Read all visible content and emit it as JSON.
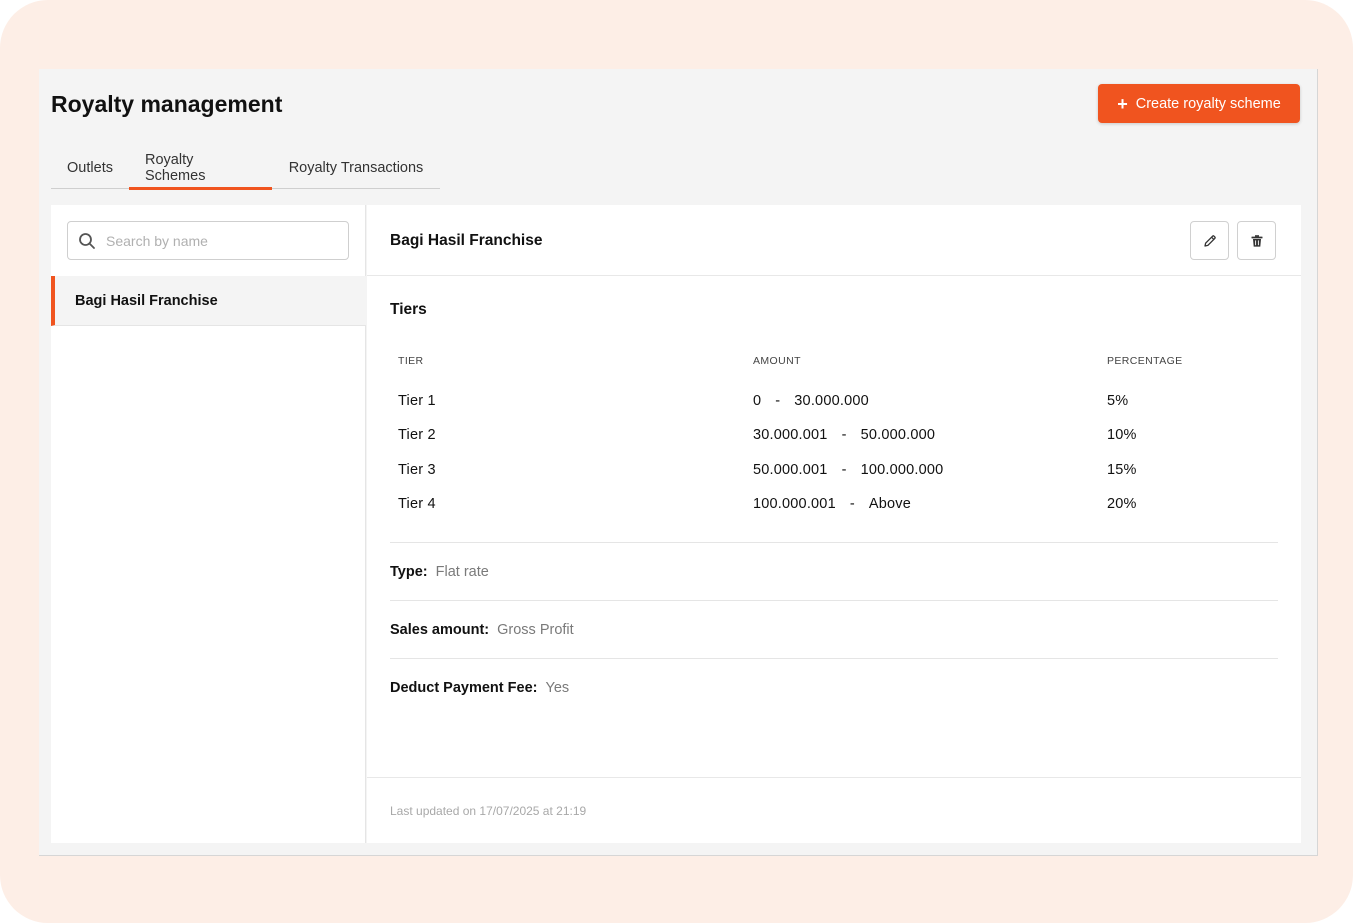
{
  "header": {
    "title": "Royalty management",
    "create_button_label": "Create royalty scheme",
    "create_button_icon": "plus-icon"
  },
  "tabs": [
    {
      "label": "Outlets",
      "active": false
    },
    {
      "label": "Royalty Schemes",
      "active": true
    },
    {
      "label": "Royalty Transactions",
      "active": false
    }
  ],
  "sidebar": {
    "search": {
      "placeholder": "Search by name",
      "value": "",
      "icon": "search-icon"
    },
    "items": [
      {
        "label": "Bagi Hasil Franchise",
        "selected": true
      }
    ]
  },
  "detail": {
    "title": "Bagi Hasil Franchise",
    "edit_icon": "pencil-icon",
    "delete_icon": "trash-icon",
    "tiers_title": "Tiers",
    "columns": {
      "tier": "TIER",
      "amount": "AMOUNT",
      "percentage": "PERCENTAGE"
    },
    "tiers": [
      {
        "tier": "Tier 1",
        "from": "0",
        "sep": "-",
        "to": "30.000.000",
        "percentage": "5%"
      },
      {
        "tier": "Tier 2",
        "from": "30.000.001",
        "sep": "-",
        "to": "50.000.000",
        "percentage": "10%"
      },
      {
        "tier": "Tier 3",
        "from": "50.000.001",
        "sep": "-",
        "to": "100.000.000",
        "percentage": "15%"
      },
      {
        "tier": "Tier 4",
        "from": "100.000.001",
        "sep": "-",
        "to": "Above",
        "percentage": "20%"
      }
    ],
    "type": {
      "label": "Type:",
      "value": "Flat rate"
    },
    "sales_amount": {
      "label": "Sales amount:",
      "value": "Gross Profit"
    },
    "deduct_fee": {
      "label": "Deduct Payment Fee:",
      "value": "Yes"
    },
    "last_updated": "Last updated on 17/07/2025 at 21:19"
  },
  "colors": {
    "accent": "#f0541f",
    "frame_bg": "#fdeee6",
    "app_bg": "#f4f4f4"
  }
}
